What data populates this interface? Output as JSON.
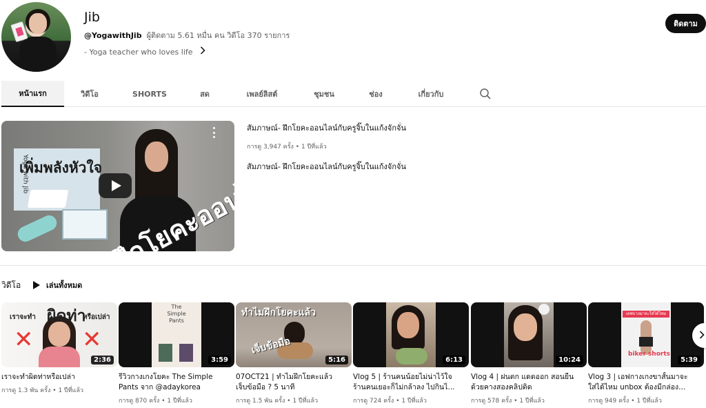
{
  "channel": {
    "name": "Jib",
    "handle": "@YogawithJib",
    "meta_rest": "ผู้ติดตาม 5.61 หมื่น คน  วิดีโอ 370 รายการ",
    "description": "- Yoga teacher who loves life",
    "subscribe_label": "ติดตาม"
  },
  "tabs": [
    {
      "label": "หน้าแรก",
      "active": true
    },
    {
      "label": "วิดีโอ",
      "active": false
    },
    {
      "label": "SHORTS",
      "active": false
    },
    {
      "label": "สด",
      "active": false
    },
    {
      "label": "เพลย์ลิสต์",
      "active": false
    },
    {
      "label": "ชุมชน",
      "active": false
    },
    {
      "label": "ช่อง",
      "active": false
    },
    {
      "label": "เกี่ยวกับ",
      "active": false
    }
  ],
  "featured": {
    "thumb_text_1": "เพิ่มพลังหัวใจ",
    "thumb_text_2": "ฝึกโยคะออนไลน์",
    "thumb_vertical": "Yoga with Jib",
    "title": "สัมภาษณ์- ฝึกโยคะออนไลน์กับครูจิ๊บในแก้งจักจั่น",
    "stats": "การดู 3,947 ครั้ง • 1 ปีที่แล้ว",
    "description": "สัมภาษณ์- ฝึกโยคะออนไลน์กับครูจิ๊บในแก้งจักจั่น"
  },
  "videos_section": {
    "title": "วิดีโอ",
    "play_all": "เล่นทั้งหมด"
  },
  "videos": [
    {
      "title_1": "เราจะทำผิดท่าหรือเปล่า",
      "title_2": "",
      "stats": "การดู 1.3 พัน ครั้ง • 1 ปีที่แล้ว",
      "duration": "2:36",
      "thumb_a": "เราจะทำ",
      "thumb_b": "ผิดท่า",
      "thumb_c": "หรือเปล่า"
    },
    {
      "title_1": "รีวิวกางเกงโยคะ The Simple",
      "title_2": "Pants จาก @adaykorea",
      "stats": "การดู 870 ครั้ง • 1 ปีที่แล้ว",
      "duration": "3:59",
      "thumb_a": "The",
      "thumb_b": "Simple",
      "thumb_c": "Pants"
    },
    {
      "title_1": "07OCT21 | ทำไมฝึกโยคะแล้ว",
      "title_2": "เจ็บข้อมือ ? 5 นาที",
      "stats": "การดู 1.5 พัน ครั้ง • 1 ปีที่แล้ว",
      "duration": "5:16",
      "thumb_a": "ทำไมฝึกโยคะแล้ว",
      "thumb_b": "เจ็บข้อมือ"
    },
    {
      "title_1": "Vlog 5 | ร้านคนน้อยไม่น่าไว้ใจ",
      "title_2": "ร้านคนเยอะก็ไม่กล้าลง ไปกินไ...",
      "stats": "การดู 724 ครั้ง • 1 ปีที่แล้ว",
      "duration": "6:13"
    },
    {
      "title_1": "Vlog 4 | ฝนตก แดดออก สอนยืน",
      "title_2": "ด้วยคางสองคลิปติด",
      "stats": "การดู 578 ครั้ง • 1 ปีที่แล้ว",
      "duration": "10:24"
    },
    {
      "title_1": "Vlog 3 | เอฟกางเกงขาสั้นมาจะ",
      "title_2": "ใส่ได้ไหม unbox ต้องมีกล่อง...",
      "stats": "การดู 949 ครั้ง • 1 ปีที่แล้ว",
      "duration": "5:39",
      "thumb_a": "เอฟบางมาจะใส่ได้ไหม",
      "thumb_b": "biker shorts"
    }
  ],
  "icons": {
    "search": "search-icon",
    "play": "play-icon",
    "kebab": "kebab-icon",
    "chevron_right": "chevron-right-icon"
  },
  "colors": {
    "primary_text": "#0f0f0f",
    "secondary_text": "#606060",
    "subscribe_bg": "#0f0f0f",
    "divider": "#e5e5e5",
    "x_mark": "#e53935"
  }
}
